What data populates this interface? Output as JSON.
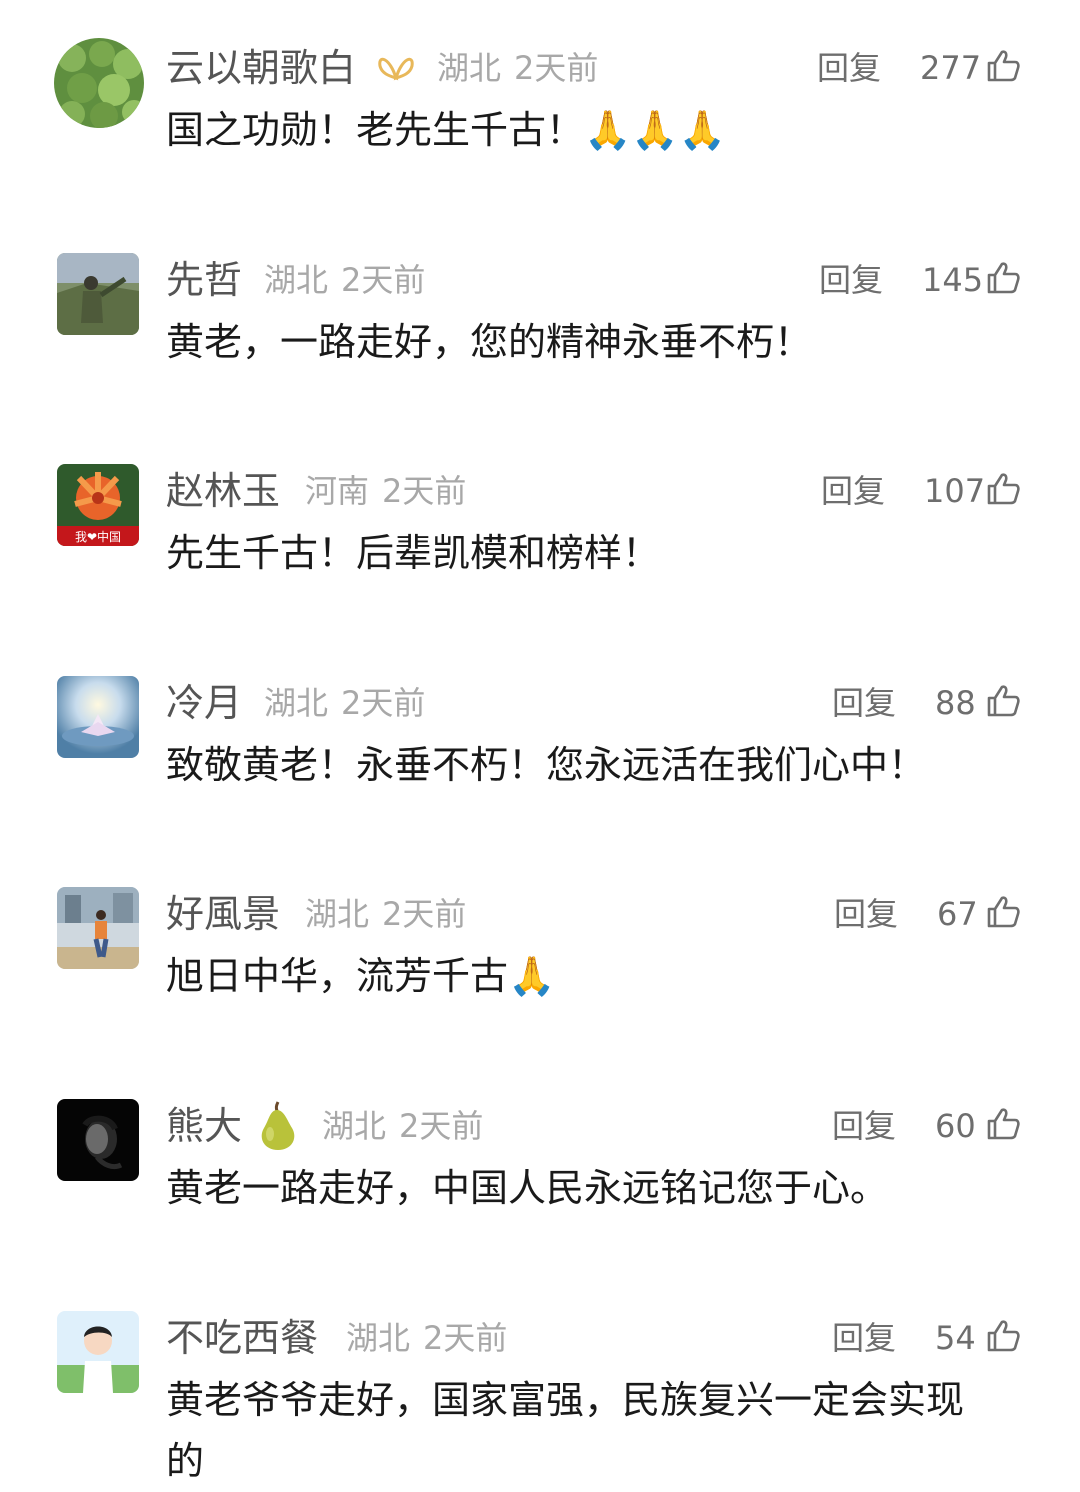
{
  "comments": [
    {
      "username": "云以朝歌白",
      "location": "湖北",
      "time": "2天前",
      "reply": "回复",
      "likes": "277",
      "text": "国之功勋！老先生千古！🙏🙏🙏"
    },
    {
      "username": "先哲",
      "location": "湖北",
      "time": "2天前",
      "reply": "回复",
      "likes": "145",
      "text": "黄老，一路走好，您的精神永垂不朽！"
    },
    {
      "username": "赵林玉",
      "location": "河南",
      "time": "2天前",
      "reply": "回复",
      "likes": "107",
      "text": "先生千古！后辈凯模和榜样！",
      "avatar_caption": "我❤中国"
    },
    {
      "username": "冷月",
      "location": "湖北",
      "time": "2天前",
      "reply": "回复",
      "likes": "88",
      "text": "致敬黄老！永垂不朽！您永远活在我们心中！"
    },
    {
      "username": "好風景",
      "location": "湖北",
      "time": "2天前",
      "reply": "回复",
      "likes": "67",
      "text": "旭日中华，流芳千古🙏"
    },
    {
      "username": "熊大",
      "location": "湖北",
      "time": "2天前",
      "reply": "回复",
      "likes": "60",
      "text": "黄老一路走好，中国人民永远铭记您于心。"
    },
    {
      "username": "不吃西餐",
      "location": "湖北",
      "time": "2天前",
      "reply": "回复",
      "likes": "54",
      "text": "黄老爷爷走好，国家富强，民族复兴一定会实现的"
    }
  ]
}
